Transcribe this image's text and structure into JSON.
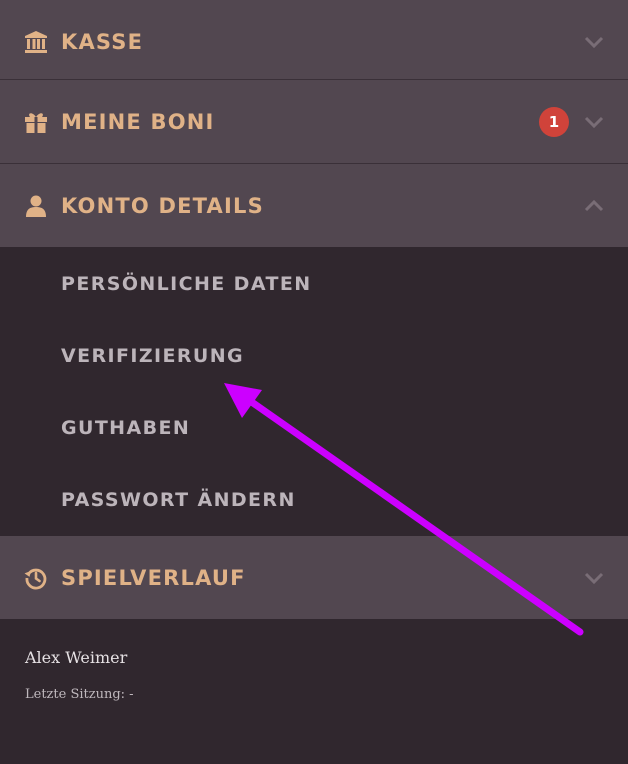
{
  "sections": {
    "kasse": {
      "label": "KASSE",
      "icon": "bank-icon",
      "expanded": false
    },
    "meine_boni": {
      "label": "MEINE BONI",
      "icon": "gift-icon",
      "badge": "1",
      "expanded": false
    },
    "konto_details": {
      "label": "KONTO DETAILS",
      "icon": "user-icon",
      "expanded": true,
      "items": [
        "PERSÖNLICHE DATEN",
        "VERIFIZIERUNG",
        "GUTHABEN",
        "PASSWORT ÄNDERN"
      ]
    },
    "spielverlauf": {
      "label": "SPIELVERLAUF",
      "icon": "history-icon",
      "expanded": false
    }
  },
  "user": {
    "name": "Alex Weimer",
    "last_session": "Letzte Sitzung: -"
  },
  "colors": {
    "header_bg": "#524750",
    "panel_bg": "#30272e",
    "accent": "#e0b287",
    "badge": "#d0433a",
    "annotation_arrow": "#cc00ff"
  }
}
